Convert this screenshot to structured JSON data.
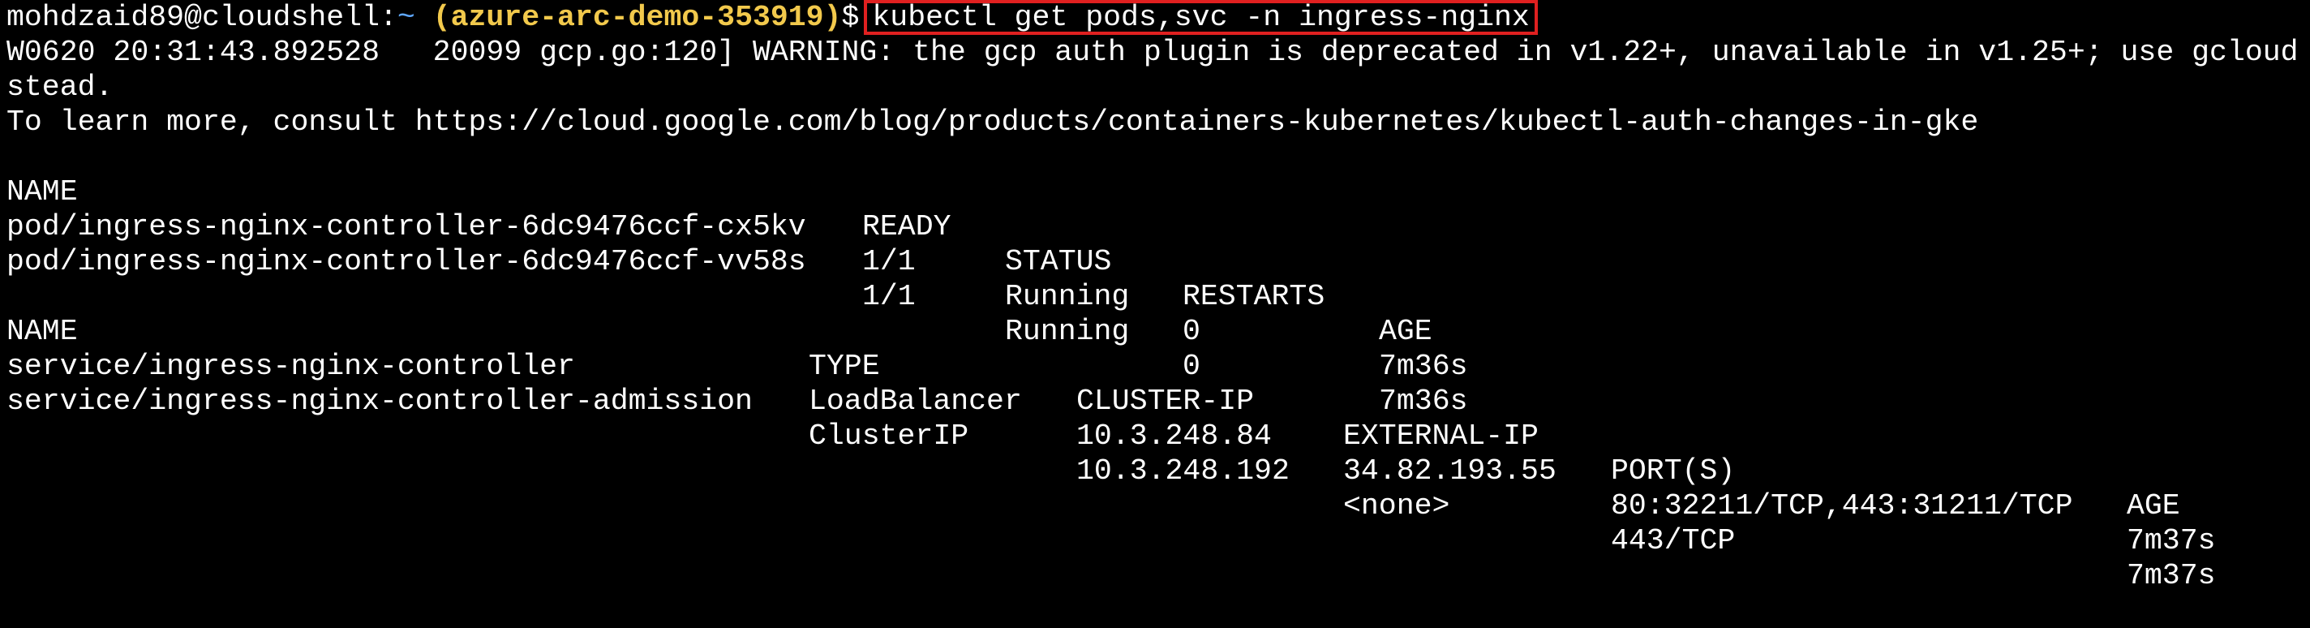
{
  "prompt": {
    "user_host": "mohdzaid89@cloudshell:",
    "path": "~",
    "project": "(azure-arc-demo-353919)",
    "symbol": "$",
    "command": "kubectl get pods,svc -n ingress-nginx"
  },
  "warning": {
    "line1": "W0620 20:31:43.892528   20099 gcp.go:120] WARNING: the gcp auth plugin is deprecated in v1.22+, unavailable in v1.25+; use gcloud",
    "line2": "stead.",
    "line3": "To learn more, consult https://cloud.google.com/blog/products/containers-kubernetes/kubectl-auth-changes-in-gke"
  },
  "pods": {
    "headers": [
      "NAME",
      "READY",
      "STATUS",
      "RESTARTS",
      "AGE"
    ],
    "rows": [
      [
        "pod/ingress-nginx-controller-6dc9476ccf-cx5kv",
        "1/1",
        "Running",
        "0",
        "7m36s"
      ],
      [
        "pod/ingress-nginx-controller-6dc9476ccf-vv58s",
        "1/1",
        "Running",
        "0",
        "7m36s"
      ]
    ]
  },
  "services": {
    "headers": [
      "NAME",
      "TYPE",
      "CLUSTER-IP",
      "EXTERNAL-IP",
      "PORT(S)",
      "AGE"
    ],
    "rows": [
      [
        "service/ingress-nginx-controller",
        "LoadBalancer",
        "10.3.248.84",
        "34.82.193.55",
        "80:32211/TCP,443:31211/TCP",
        "7m37s"
      ],
      [
        "service/ingress-nginx-controller-admission",
        "ClusterIP",
        "10.3.248.192",
        "<none>",
        "443/TCP",
        "7m37s"
      ]
    ]
  },
  "colors": {
    "background": "#000000",
    "text": "#ffffff",
    "path": "#5fa8ff",
    "project": "#f2c94c",
    "highlight_box": "#e02020"
  }
}
